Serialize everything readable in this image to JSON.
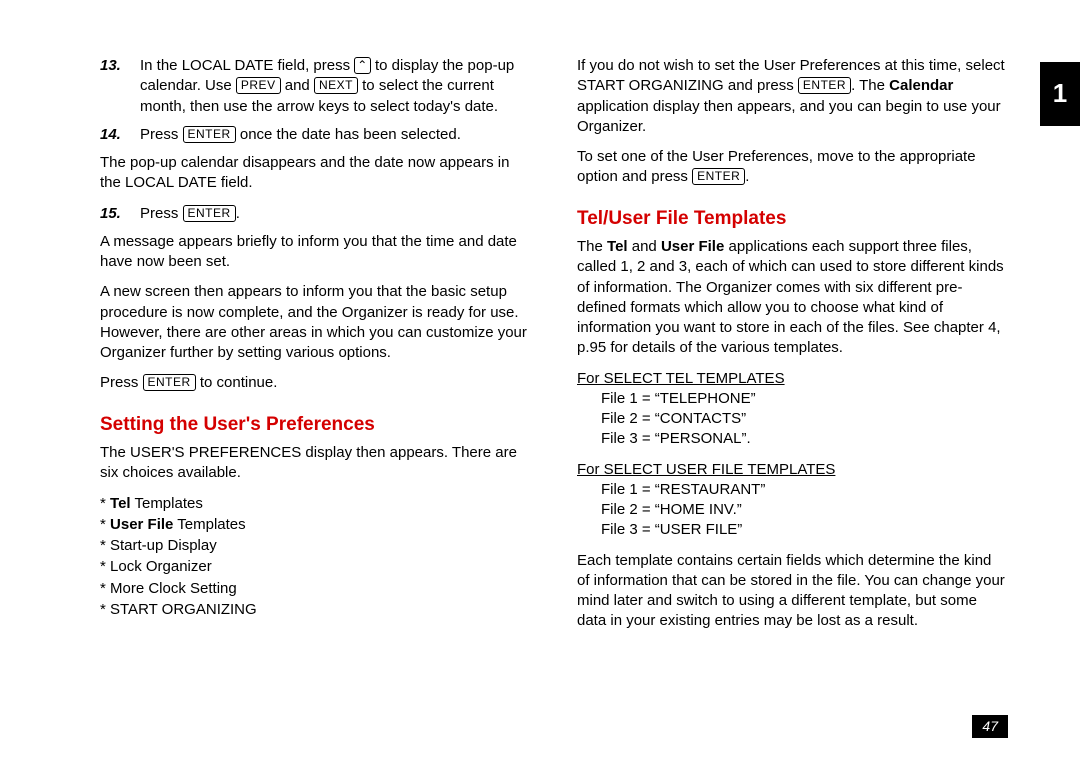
{
  "page_number": "47",
  "tab_label": "1",
  "left": {
    "step13": {
      "num": "13.",
      "t1": "In the LOCAL DATE field, press ",
      "key1": "⌃",
      "t2": " to display the pop-up calendar. Use ",
      "key2": "PREV",
      "t3": " and ",
      "key3": "NEXT",
      "t4": " to select the current month, then use the arrow keys to select today's date."
    },
    "step14": {
      "num": "14.",
      "t1": "Press ",
      "key1": "ENTER",
      "t2": " once the date has been selected."
    },
    "para_after14": "The pop-up calendar disappears and the date now appears in the LOCAL DATE field.",
    "step15": {
      "num": "15.",
      "t1": "Press ",
      "key1": "ENTER",
      "t2": "."
    },
    "para_msg": "A message appears briefly to inform you that the time and date have now been set.",
    "para_newscreen": "A new screen then appears to inform you that the basic setup procedure is now complete, and the Organizer is ready for use. However, there are other areas in which you can customize your Organizer further by setting various options.",
    "press_cont_1": "Press ",
    "press_cont_key": "ENTER",
    "press_cont_2": " to continue.",
    "h_setting": "Setting the User's Preferences",
    "para_userprefs": "The USER'S PREFERENCES display then appears. There are six choices available.",
    "choices": {
      "c1_pre": "* ",
      "c1_bold": "Tel",
      "c1_rest": " Templates",
      "c2_pre": "* ",
      "c2_bold": "User File",
      "c2_rest": " Templates",
      "c3": "* Start-up Display",
      "c4": "* Lock Organizer",
      "c5": "* More Clock Setting",
      "c6": "* START ORGANIZING"
    }
  },
  "right": {
    "para_nowish_1": "If you do not wish to set the User Preferences at this time, select START ORGANIZING and press ",
    "para_nowish_key": "ENTER",
    "para_nowish_2": ". The ",
    "para_nowish_bold": "Calendar",
    "para_nowish_3": " application display then appears, and you can begin to use your Organizer.",
    "para_setone_1": "To set one of the User Preferences, move to the appropriate option and press ",
    "para_setone_key": "ENTER",
    "para_setone_2": ".",
    "h_teluser": "Tel/User File Templates",
    "para_intro_1": "The ",
    "para_intro_bold1": "Tel",
    "para_intro_2": " and ",
    "para_intro_bold2": "User File",
    "para_intro_3": " applications each support three files, called 1, 2 and 3, each of which can used to store different kinds of information. The Organizer comes with six different pre-defined formats which allow you to choose what kind of information you want to store in each of the files. See chapter 4, p.95 for details of the various templates.",
    "tel_head": "For SELECT TEL TEMPLATES",
    "tel1": "File 1 = “TELEPHONE”",
    "tel2": "File 2 = “CONTACTS”",
    "tel3": "File 3 = “PERSONAL”.",
    "user_head": "For SELECT USER FILE TEMPLATES",
    "user1": "File 1 = “RESTAURANT”",
    "user2": "File 2 = “HOME INV.”",
    "user3": "File 3 = “USER FILE”",
    "para_tail": "Each template contains certain fields which determine the kind of information that can be stored in the file. You can change your mind later and switch to using a different template, but some data in your existing entries may be lost as a result."
  }
}
